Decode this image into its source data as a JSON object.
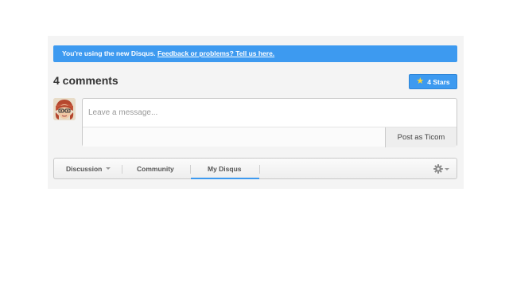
{
  "banner": {
    "text": "You're using the new Disqus.",
    "link": "Feedback or problems? Tell us here."
  },
  "comments": {
    "count_label": "4 comments"
  },
  "stars": {
    "label": "4 Stars",
    "icon": "star-icon"
  },
  "composer": {
    "placeholder": "Leave a message...",
    "post_label": "Post as Ticom"
  },
  "nav": {
    "tabs": [
      {
        "label": "Discussion",
        "icon": "chevron-down-icon"
      },
      {
        "label": "Community"
      },
      {
        "label": "My Disqus"
      }
    ],
    "settings_icon": "gear-icon"
  },
  "colors": {
    "accent": "#3d9af0",
    "star": "#ffd633"
  }
}
